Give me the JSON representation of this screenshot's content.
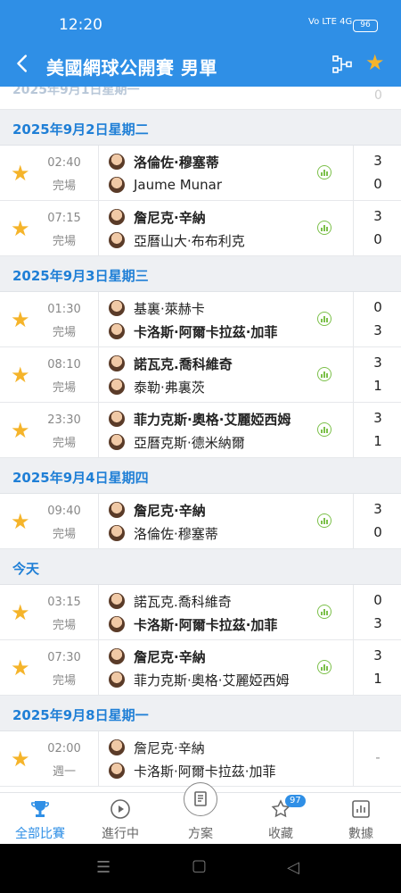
{
  "status": {
    "time": "12:20",
    "signal": "Vo LTE 4G",
    "battery": "96"
  },
  "header": {
    "title": "美國網球公開賽 男單",
    "back_label": "<"
  },
  "partial_row": {
    "date": "2025年9月1日星期一",
    "score": "0"
  },
  "sections": [
    {
      "date": "2025年9月2日星期二",
      "matches": [
        {
          "time": "02:40",
          "status": "完場",
          "p1": "洛倫佐·穆塞蒂",
          "p2": "Jaume Munar",
          "s1": "3",
          "s2": "0",
          "p1_bold": true,
          "p2_bold": false
        },
        {
          "time": "07:15",
          "status": "完場",
          "p1": "詹尼克·辛納",
          "p2": "亞曆山大·布布利克",
          "s1": "3",
          "s2": "0",
          "p1_bold": true,
          "p2_bold": false
        }
      ]
    },
    {
      "date": "2025年9月3日星期三",
      "matches": [
        {
          "time": "01:30",
          "status": "完場",
          "p1": "基裏·萊赫卡",
          "p2": "卡洛斯·阿爾卡拉茲·加菲",
          "s1": "0",
          "s2": "3",
          "p1_bold": false,
          "p2_bold": true
        },
        {
          "time": "08:10",
          "status": "完場",
          "p1": "諾瓦克.喬科維奇",
          "p2": "泰勒·弗裏茨",
          "s1": "3",
          "s2": "1",
          "p1_bold": true,
          "p2_bold": false
        },
        {
          "time": "23:30",
          "status": "完場",
          "p1": "菲力克斯·奧格·艾麗婭西姆",
          "p2": "亞曆克斯·德米納爾",
          "s1": "3",
          "s2": "1",
          "p1_bold": true,
          "p2_bold": false
        }
      ]
    },
    {
      "date": "2025年9月4日星期四",
      "matches": [
        {
          "time": "09:40",
          "status": "完場",
          "p1": "詹尼克·辛納",
          "p2": "洛倫佐·穆塞蒂",
          "s1": "3",
          "s2": "0",
          "p1_bold": true,
          "p2_bold": false
        }
      ]
    },
    {
      "date": "今天",
      "matches": [
        {
          "time": "03:15",
          "status": "完場",
          "p1": "諾瓦克.喬科維奇",
          "p2": "卡洛斯·阿爾卡拉茲·加菲",
          "s1": "0",
          "s2": "3",
          "p1_bold": false,
          "p2_bold": true
        },
        {
          "time": "07:30",
          "status": "完場",
          "p1": "詹尼克·辛納",
          "p2": "菲力克斯·奧格·艾麗婭西姆",
          "s1": "3",
          "s2": "1",
          "p1_bold": true,
          "p2_bold": false
        }
      ]
    },
    {
      "date": "2025年9月8日星期一",
      "matches": [
        {
          "time": "02:00",
          "status": "週一",
          "p1": "詹尼克·辛納",
          "p2": "卡洛斯·阿爾卡拉茲·加菲",
          "s1": "-",
          "s2": "",
          "p1_bold": false,
          "p2_bold": false
        }
      ]
    }
  ],
  "nav": [
    {
      "label": "全部比賽",
      "icon": "trophy-icon",
      "active": true
    },
    {
      "label": "進行中",
      "icon": "play-icon",
      "active": false
    },
    {
      "label": "方案",
      "icon": "document-icon",
      "active": false
    },
    {
      "label": "收藏",
      "icon": "star-outline-icon",
      "active": false,
      "badge": "97"
    },
    {
      "label": "數據",
      "icon": "bar-chart-icon",
      "active": false
    }
  ],
  "colors": {
    "primary": "#2f8fe6",
    "star": "#f5b42a",
    "stats": "#7cc04a"
  }
}
